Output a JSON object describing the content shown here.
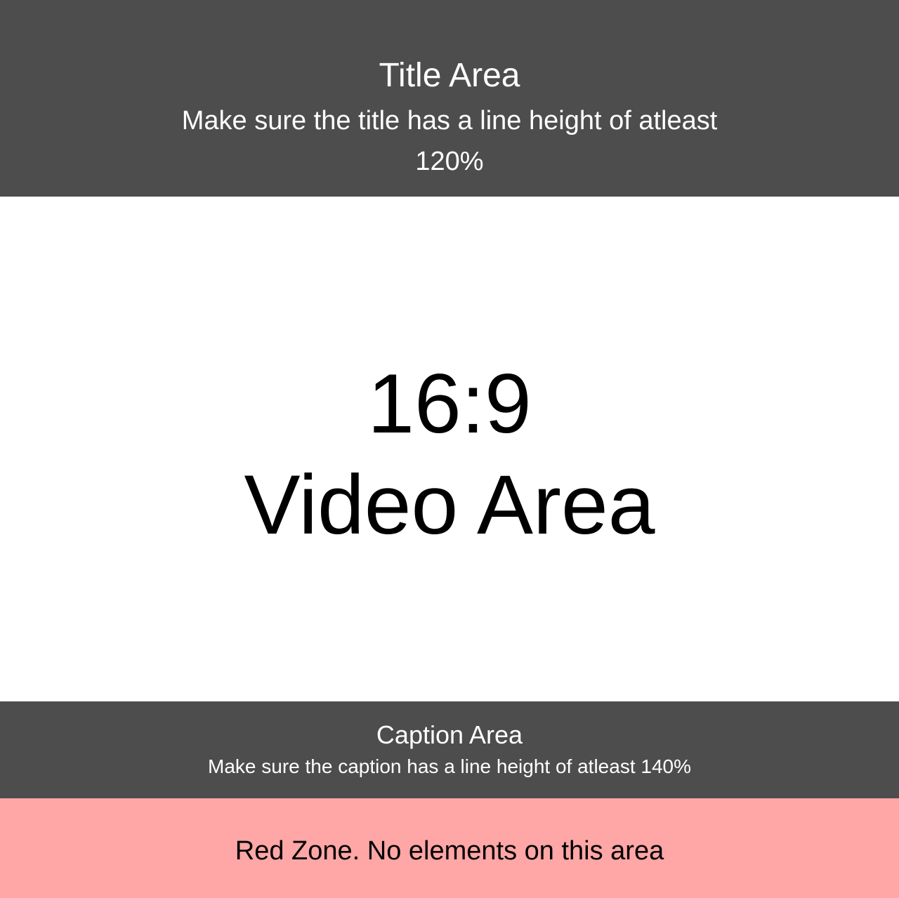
{
  "title_area": {
    "heading": "Title Area",
    "note": "Make sure the title has a line height of atleast 120%"
  },
  "video_area": {
    "ratio": "16:9",
    "label": "Video Area"
  },
  "caption_area": {
    "heading": "Caption Area",
    "note": "Make sure the caption has a line height of atleast 140%"
  },
  "red_zone": {
    "label": "Red Zone. No elements on this area"
  },
  "colors": {
    "dark_band": "#4d4d4d",
    "video_bg": "#ffffff",
    "red_zone": "#ffa6a6"
  }
}
